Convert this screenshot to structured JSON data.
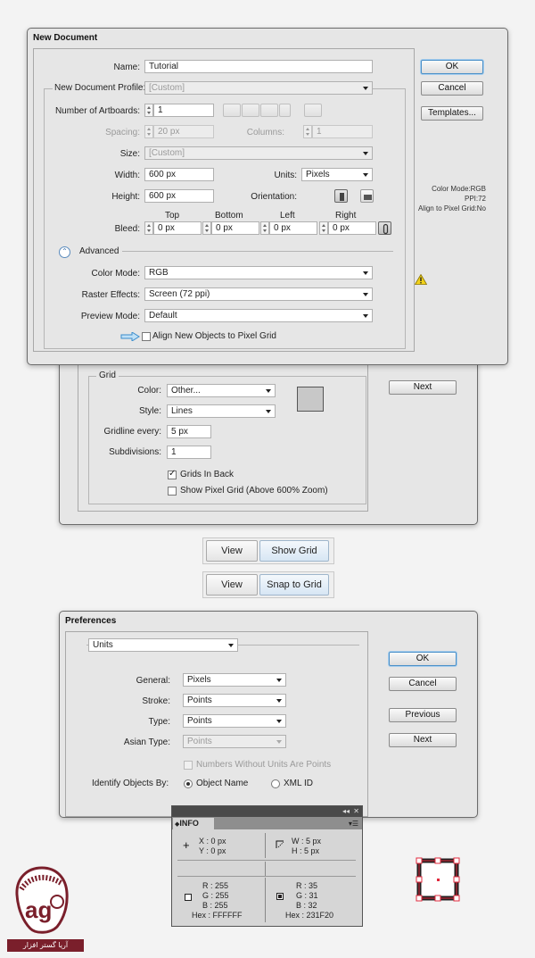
{
  "new_document": {
    "title": "New Document",
    "name_label": "Name:",
    "name_value": "Tutorial",
    "profile_label": "New Document Profile:",
    "profile_value": "[Custom]",
    "artboards_label": "Number of Artboards:",
    "artboards_value": "1",
    "spacing_label": "Spacing:",
    "spacing_value": "20 px",
    "columns_label": "Columns:",
    "columns_value": "1",
    "size_label": "Size:",
    "size_value": "[Custom]",
    "width_label": "Width:",
    "width_value": "600 px",
    "units_label": "Units:",
    "units_value": "Pixels",
    "height_label": "Height:",
    "height_value": "600 px",
    "orientation_label": "Orientation:",
    "bleed_label": "Bleed:",
    "bleed_headers": [
      "Top",
      "Bottom",
      "Left",
      "Right"
    ],
    "bleed_values": [
      "0 px",
      "0 px",
      "0 px",
      "0 px"
    ],
    "advanced_label": "Advanced",
    "color_mode_label": "Color Mode:",
    "color_mode_value": "RGB",
    "raster_label": "Raster Effects:",
    "raster_value": "Screen (72 ppi)",
    "preview_label": "Preview Mode:",
    "preview_value": "Default",
    "align_label": "Align New Objects to Pixel Grid",
    "ok": "OK",
    "cancel": "Cancel",
    "templates": "Templates...",
    "info_lines": [
      "Color Mode:RGB",
      "PPI:72",
      "Align to Pixel Grid:No"
    ]
  },
  "grid_prefs": {
    "group_title": "Grid",
    "color_label": "Color:",
    "color_value": "Other...",
    "style_label": "Style:",
    "style_value": "Lines",
    "gridline_label": "Gridline every:",
    "gridline_value": "5 px",
    "subdivisions_label": "Subdivisions:",
    "subdivisions_value": "1",
    "grids_in_back": "Grids In Back",
    "show_pixel_grid": "Show Pixel Grid (Above 600% Zoom)",
    "next": "Next",
    "swatch_color": "#c8c8c8"
  },
  "menus": [
    {
      "menu": "View",
      "item": "Show Grid"
    },
    {
      "menu": "View",
      "item": "Snap to Grid"
    }
  ],
  "preferences": {
    "title": "Preferences",
    "section": "Units",
    "general_label": "General:",
    "general_value": "Pixels",
    "stroke_label": "Stroke:",
    "stroke_value": "Points",
    "type_label": "Type:",
    "type_value": "Points",
    "asian_label": "Asian Type:",
    "asian_value": "Points",
    "numbers_label": "Numbers Without Units Are Points",
    "identify_label": "Identify Objects By:",
    "object_name": "Object Name",
    "xml_id": "XML ID",
    "ok": "OK",
    "cancel": "Cancel",
    "previous": "Previous",
    "next": "Next"
  },
  "info_panel": {
    "title": "INFO",
    "x": "X : 0 px",
    "y": "Y : 0 px",
    "w": "W : 5 px",
    "h": "H : 5 px",
    "left_r": "R : 255",
    "left_g": "G : 255",
    "left_b": "B : 255",
    "left_hex": "Hex : FFFFFF",
    "right_r": "R : 35",
    "right_g": "G : 31",
    "right_b": "B : 32",
    "right_hex": "Hex : 231F20",
    "fill_color": "#ffffff",
    "stroke_color": "#231F20"
  },
  "watermark": {
    "text": "آریا گستر افزار",
    "accent": "#7a1f2b"
  },
  "colors": {
    "selection_red": "#e0283c",
    "accent_blue": "#4a8fc8"
  }
}
